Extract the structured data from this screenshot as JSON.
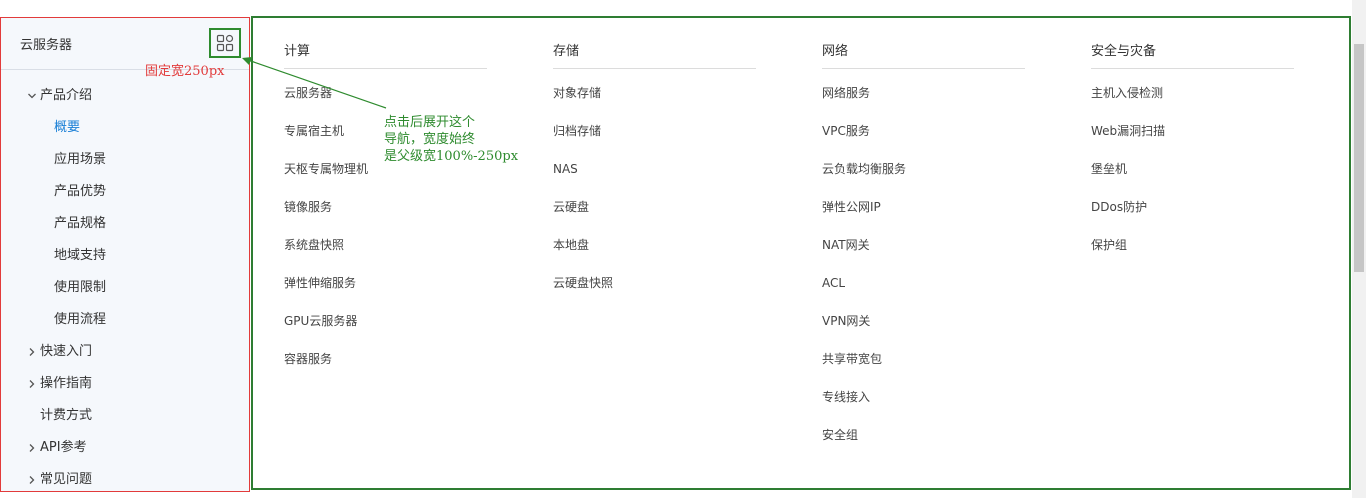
{
  "sidebar": {
    "title": "云服务器",
    "items": [
      {
        "label": "产品介绍",
        "type": "top",
        "expanded": true
      },
      {
        "label": "概要",
        "type": "sub",
        "active": true
      },
      {
        "label": "应用场景",
        "type": "sub"
      },
      {
        "label": "产品优势",
        "type": "sub"
      },
      {
        "label": "产品规格",
        "type": "sub"
      },
      {
        "label": "地域支持",
        "type": "sub"
      },
      {
        "label": "使用限制",
        "type": "sub"
      },
      {
        "label": "使用流程",
        "type": "sub"
      },
      {
        "label": "快速入门",
        "type": "top"
      },
      {
        "label": "操作指南",
        "type": "top"
      },
      {
        "label": "计费方式",
        "type": "top-noicon"
      },
      {
        "label": "API参考",
        "type": "top"
      },
      {
        "label": "常见问题",
        "type": "top"
      }
    ]
  },
  "annotations": {
    "fixed_width": "固定宽250px",
    "expand_line1": "点击后展开这个",
    "expand_line2": "导航，宽度始终",
    "expand_line3": "是父级宽100%-250px"
  },
  "panel": {
    "columns": [
      {
        "title": "计算",
        "items": [
          "云服务器",
          "专属宿主机",
          "天枢专属物理机",
          "镜像服务",
          "系统盘快照",
          "弹性伸缩服务",
          "GPU云服务器",
          "容器服务"
        ]
      },
      {
        "title": "存储",
        "items": [
          "对象存储",
          "归档存储",
          "NAS",
          "云硬盘",
          "本地盘",
          "云硬盘快照"
        ]
      },
      {
        "title": "网络",
        "items": [
          "网络服务",
          "VPC服务",
          "云负载均衡服务",
          "弹性公网IP",
          "NAT网关",
          "ACL",
          "VPN网关",
          "共享带宽包",
          "专线接入",
          "安全组"
        ]
      },
      {
        "title": "安全与灾备",
        "items": [
          "主机入侵检测",
          "Web漏洞扫描",
          "堡垒机",
          "DDos防护",
          "保护组"
        ]
      }
    ]
  },
  "colors": {
    "sidebar_border": "#e23b3b",
    "panel_border": "#2e7d32",
    "active": "#1a7fd6",
    "annotation_green": "#2e8b2e",
    "annotation_red": "#e23b3b"
  }
}
